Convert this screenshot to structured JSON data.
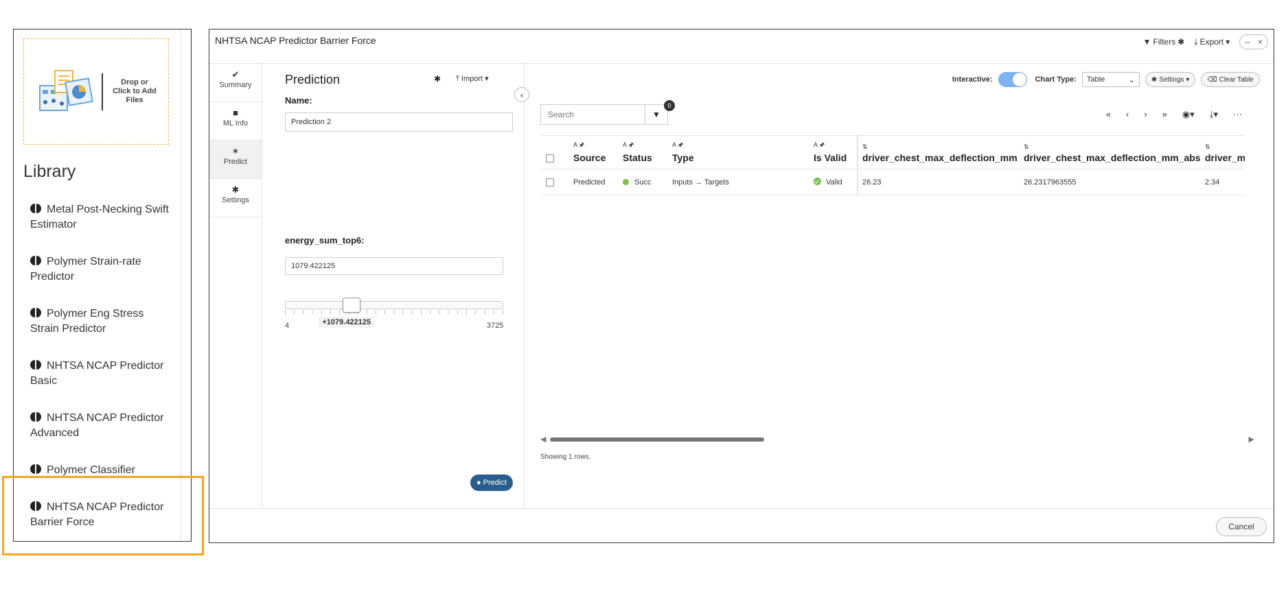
{
  "dropzone": {
    "text": "Drop or Click to Add Files",
    "icon": "documents-chart-icon"
  },
  "library": {
    "title": "Library",
    "items": [
      {
        "label": "Metal Post-Necking Swift Estimator"
      },
      {
        "label": "Polymer Strain-rate Predictor"
      },
      {
        "label": "Polymer Eng Stress Strain Predictor"
      },
      {
        "label": "NHTSA NCAP Predictor Basic"
      },
      {
        "label": "NHTSA NCAP Predictor Advanced"
      },
      {
        "label": "Polymer Classifier"
      },
      {
        "label": "NHTSA NCAP Predictor Barrier Force"
      }
    ],
    "highlighted_index": 6,
    "highlight_color": "#f7a51c"
  },
  "window": {
    "title": "NHTSA NCAP Predictor Barrier Force",
    "filters_label": "Filters",
    "export_label": "Export",
    "minimize": "–",
    "close": "×"
  },
  "nav": {
    "items": [
      {
        "label": "Summary",
        "icon": "double-check-icon",
        "glyph": "✔"
      },
      {
        "label": "ML Info",
        "icon": "file-icon",
        "glyph": "■"
      },
      {
        "label": "Predict",
        "icon": "magic-wand-icon",
        "glyph": "✶"
      },
      {
        "label": "Settings",
        "icon": "gear-icon",
        "glyph": "✱"
      }
    ],
    "active": "Predict"
  },
  "form": {
    "title": "Prediction",
    "import_label": "Import",
    "name_label": "Name:",
    "name_value": "Prediction 2",
    "param_label": "energy_sum_top6:",
    "param_value": "1079.422125",
    "slider_min": "4",
    "slider_max": "3725",
    "slider_tooltip": "+1079.422125",
    "slider_level": 0.289,
    "predict_label": "Predict"
  },
  "toolbar": {
    "interactive_label": "Interactive:",
    "chart_type_label": "Chart Type:",
    "chart_type_value": "Table",
    "settings_label": "Settings",
    "clear_label": "Clear Table",
    "search_placeholder": "Search",
    "filter_count": "0",
    "pager": [
      "«",
      "‹",
      "›",
      "»",
      "◉▾",
      "⤓▾",
      "···"
    ]
  },
  "table": {
    "columns": [
      {
        "tag": "A 🖈",
        "label": "Source"
      },
      {
        "tag": "A 🖈",
        "label": "Status"
      },
      {
        "tag": "A 🖈",
        "label": "Type"
      },
      {
        "tag": "A 🖈",
        "label": "Is Valid"
      },
      {
        "tag": "⇅",
        "label": "driver_chest_max_deflection_mm"
      },
      {
        "tag": "⇅",
        "label": "driver_chest_max_deflection_mm_abs"
      },
      {
        "tag": "⇅",
        "label": "driver_m"
      }
    ],
    "rows": [
      {
        "source": "Predicted",
        "status": "Succ",
        "type": "Inputs → Targets",
        "valid": "Valid",
        "c5": "26.23",
        "c6": "26.2317963555",
        "c7": "2.34"
      }
    ],
    "showing": "Showing 1 rows."
  },
  "footer": {
    "cancel_label": "Cancel"
  },
  "colors": {
    "accent": "#2a5d8f",
    "toggle_on": "#7db3ef",
    "status_success": "#7cc04b",
    "valid": "#7cc04b"
  }
}
